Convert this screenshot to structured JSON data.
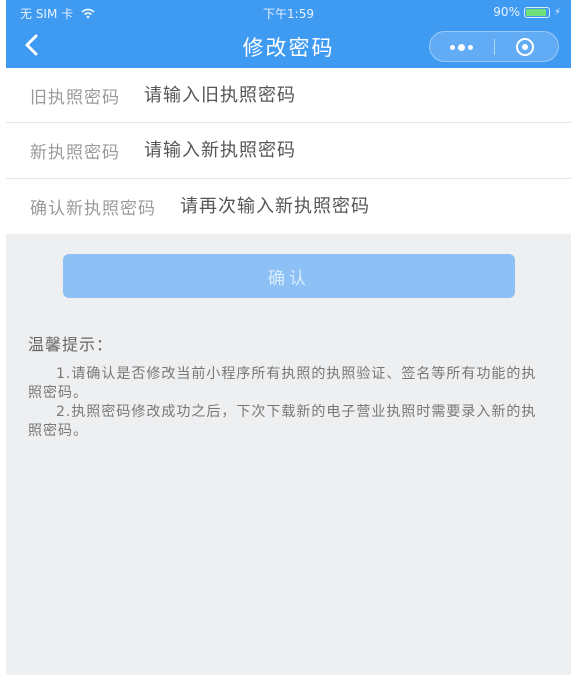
{
  "status_bar": {
    "carrier": "无 SIM 卡",
    "time": "下午1:59",
    "battery_pct": "90%",
    "battery_level": 0.9,
    "wifi_icon": "wifi-icon",
    "charging_icon": "charging-icon"
  },
  "nav": {
    "title": "修改密码",
    "back_icon": "back-arrow-icon",
    "more_icon": "more-dots-icon",
    "close_icon": "miniprogram-close-icon"
  },
  "form": {
    "old": {
      "label": "旧执照密码",
      "placeholder": "请输入旧执照密码"
    },
    "new": {
      "label": "新执照密码",
      "placeholder": "请输入新执照密码"
    },
    "confirm_pw": {
      "label": "确认新执照密码",
      "placeholder": "请再次输入新执照密码"
    }
  },
  "confirm_button": "确认",
  "tips": {
    "title": "温馨提示：",
    "items": [
      "1.请确认是否修改当前小程序所有执照的执照验证、签名等所有功能的执照密码。",
      "2.执照密码修改成功之后，下次下载新的电子营业执照时需要录入新的执照密码。"
    ]
  },
  "colors": {
    "header": "#3f9af2",
    "button": "#8dc1f5",
    "background": "#eeeff1"
  }
}
